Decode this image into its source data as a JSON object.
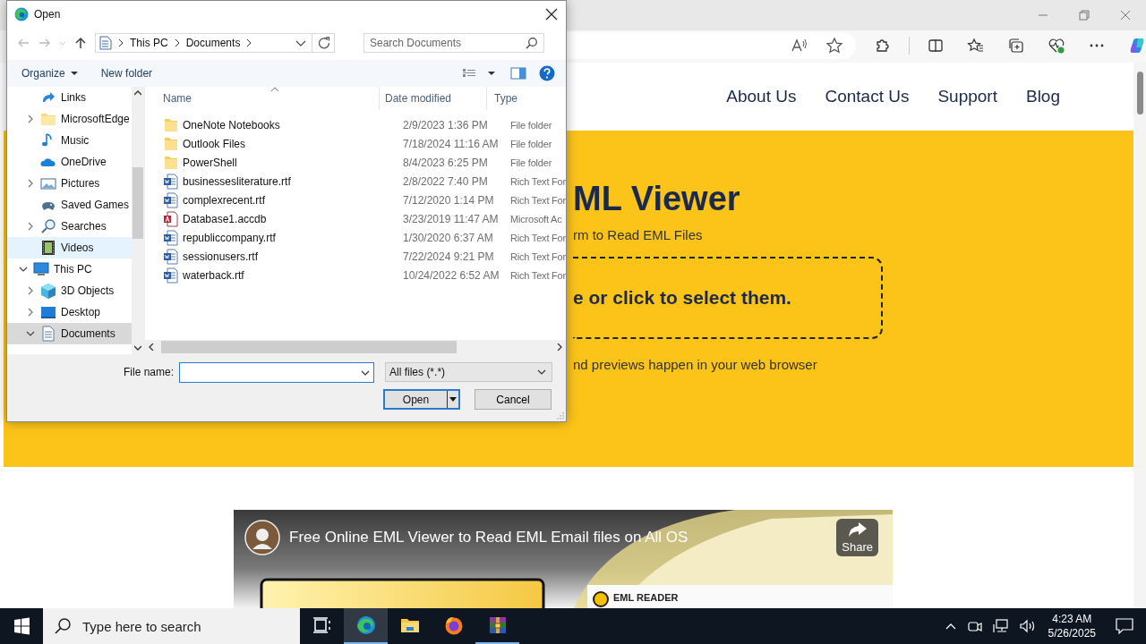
{
  "site": {
    "nav": [
      "About Us",
      "Contact Us",
      "Support",
      "Blog"
    ],
    "hero": {
      "title": "ML Viewer",
      "subtitle": "rm to Read EML Files",
      "dropzone": "e or click to select them.",
      "note": "nd previews happen in your web browser"
    },
    "video": {
      "title": "Free Online EML Viewer to Read EML Email files on All OS",
      "share": "Share",
      "card_label": "EML READER"
    }
  },
  "dialog": {
    "title": "Open",
    "breadcrumb": [
      "This PC",
      "Documents"
    ],
    "search": {
      "placeholder": "Search Documents"
    },
    "toolbar": {
      "organize": "Organize",
      "new_folder": "New folder"
    },
    "tree": {
      "outer_items": [
        {
          "label": "Links",
          "kind": "link",
          "expandable": false,
          "selected": false,
          "hovered": false
        },
        {
          "label": "MicrosoftEdge",
          "kind": "folder",
          "expandable": true,
          "expanded": false,
          "selected": false,
          "hovered": false
        },
        {
          "label": "Music",
          "kind": "music",
          "expandable": false,
          "selected": false,
          "hovered": false
        },
        {
          "label": "OneDrive",
          "kind": "cloud",
          "expandable": false,
          "selected": false,
          "hovered": false
        },
        {
          "label": "Pictures",
          "kind": "picture",
          "expandable": true,
          "expanded": false,
          "selected": false,
          "hovered": false
        },
        {
          "label": "Saved Games",
          "kind": "games",
          "expandable": false,
          "selected": false,
          "hovered": false
        },
        {
          "label": "Searches",
          "kind": "search",
          "expandable": true,
          "expanded": false,
          "selected": false,
          "hovered": false
        },
        {
          "label": "Videos",
          "kind": "film",
          "expandable": false,
          "selected": false,
          "hovered": true
        }
      ],
      "items": [
        {
          "label": "This PC",
          "kind": "pc",
          "expandable": true,
          "expanded": true,
          "selected": false,
          "hovered": false,
          "children": [
            {
              "label": "3D Objects",
              "kind": "cube",
              "expandable": true,
              "expanded": false,
              "selected": false,
              "hovered": false
            },
            {
              "label": "Desktop",
              "kind": "desktop",
              "expandable": true,
              "expanded": false,
              "selected": false,
              "hovered": false
            },
            {
              "label": "Documents",
              "kind": "document",
              "expandable": true,
              "expanded": true,
              "selected": true,
              "hovered": false
            }
          ]
        }
      ]
    },
    "columns": [
      "Name",
      "Date modified",
      "Type"
    ],
    "files": [
      {
        "name": "OneNote Notebooks",
        "date": "2/9/2023 1:36 PM",
        "type": "File folder",
        "kind": "folder"
      },
      {
        "name": "Outlook Files",
        "date": "7/18/2024 11:16 AM",
        "type": "File folder",
        "kind": "folder"
      },
      {
        "name": "PowerShell",
        "date": "8/4/2023 6:25 PM",
        "type": "File folder",
        "kind": "folder"
      },
      {
        "name": "businessesliterature.rtf",
        "date": "2/8/2022 7:40 PM",
        "type": "Rich Text For",
        "kind": "rtf"
      },
      {
        "name": "complexrecent.rtf",
        "date": "7/12/2020 1:14 PM",
        "type": "Rich Text For",
        "kind": "rtf"
      },
      {
        "name": "Database1.accdb",
        "date": "3/23/2019 11:47 AM",
        "type": "Microsoft Ac",
        "kind": "access"
      },
      {
        "name": "republiccompany.rtf",
        "date": "1/30/2020 6:37 AM",
        "type": "Rich Text For",
        "kind": "rtf"
      },
      {
        "name": "sessionusers.rtf",
        "date": "7/22/2024 9:21 PM",
        "type": "Rich Text For",
        "kind": "rtf"
      },
      {
        "name": "waterback.rtf",
        "date": "10/24/2022 6:52 AM",
        "type": "Rich Text For",
        "kind": "rtf"
      }
    ],
    "file_name_label": "File name:",
    "filter": "All files (*.*)",
    "buttons": {
      "open": "Open",
      "cancel": "Cancel"
    }
  },
  "taskbar": {
    "search_placeholder": "Type here to search",
    "apps": [
      {
        "kind": "taskview",
        "active": false
      },
      {
        "kind": "edge",
        "active": true
      },
      {
        "kind": "explorer",
        "active": false
      },
      {
        "kind": "firefox",
        "active": false
      },
      {
        "kind": "winrar",
        "active": true
      }
    ],
    "time": "4:23 AM",
    "date": "5/26/2025"
  }
}
